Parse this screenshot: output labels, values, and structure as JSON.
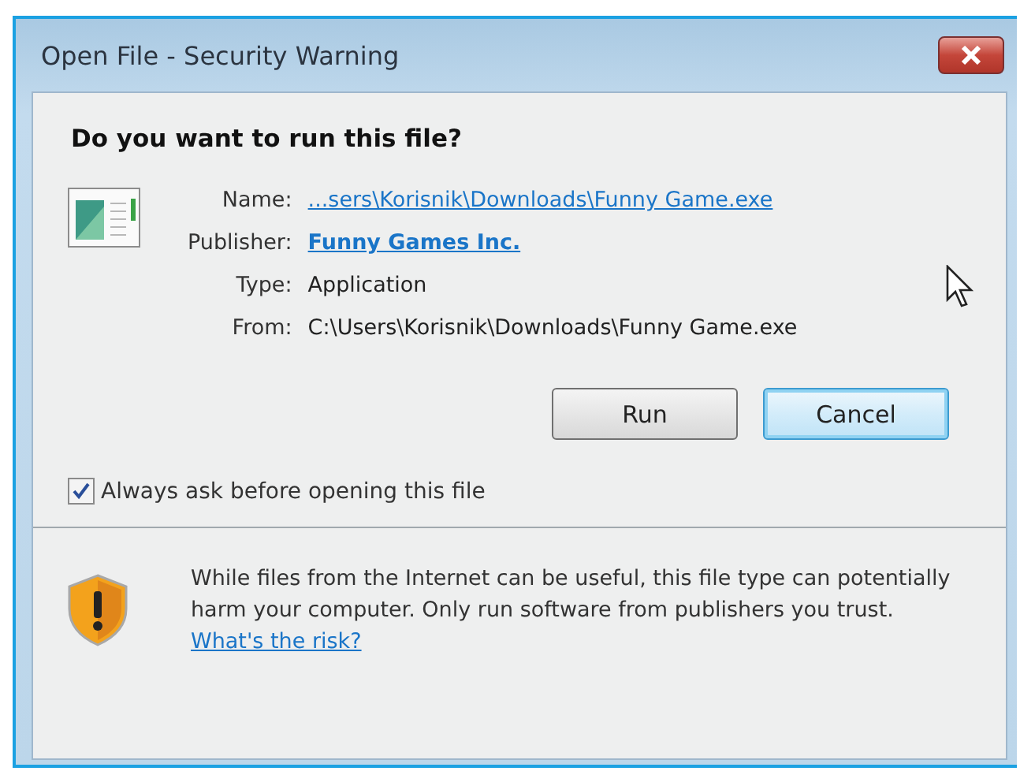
{
  "window": {
    "title": "Open File - Security Warning"
  },
  "heading": "Do you want to run this file?",
  "details": [
    {
      "label": "Name:",
      "value": "...sers\\Korisnik\\Downloads\\Funny Game.exe",
      "kind": "link"
    },
    {
      "label": "Publisher:",
      "value": "Funny Games Inc.",
      "kind": "bold-link"
    },
    {
      "label": "Type:",
      "value": "Application",
      "kind": "text"
    },
    {
      "label": "From:",
      "value": "C:\\Users\\Korisnik\\Downloads\\Funny Game.exe",
      "kind": "text"
    }
  ],
  "buttons": [
    {
      "label": "Run",
      "selected": false
    },
    {
      "label": "Cancel",
      "selected": true
    }
  ],
  "checkbox": {
    "label": "Always ask before opening this file",
    "checked": true
  },
  "warning": {
    "text": "While files from the Internet can be useful, this file type can potentially harm your computer. Only run software from publishers you trust.",
    "link": "What's the risk?"
  }
}
